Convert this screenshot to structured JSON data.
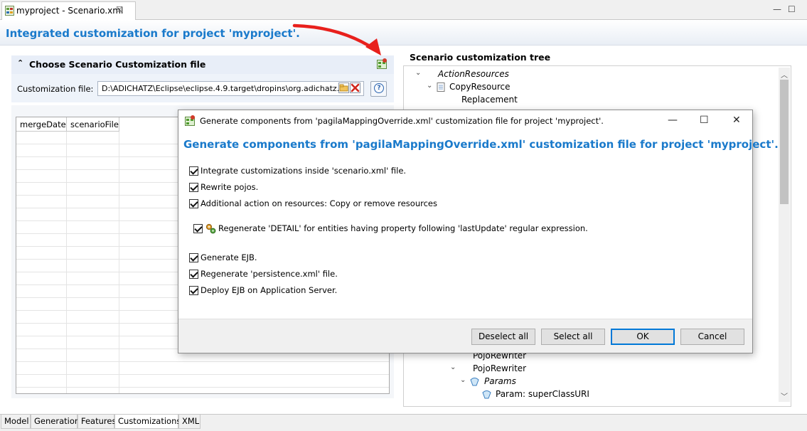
{
  "editor": {
    "tab_label": "myproject - Scenario.xml",
    "tab_close": "☒",
    "minimize": "—",
    "maximize": "☐",
    "title": "Integrated customization for project 'myproject'."
  },
  "section": {
    "title": "Choose Scenario Customization file",
    "twisty": "⌃",
    "field_label": "Customization file:",
    "field_value": "D:\\ADICHATZ\\Eclipse\\eclipse.4.9.target\\dropins\\org.adichatz.",
    "help_glyph": "?"
  },
  "table": {
    "columns": [
      "mergeDate",
      "scenarioFile"
    ]
  },
  "tree": {
    "title": "Scenario customization tree",
    "nodes": [
      {
        "label": "ActionResources",
        "expanded": "⌄"
      },
      {
        "label": "CopyResource",
        "expanded": "⌄"
      },
      {
        "label": "Replacement"
      },
      {
        "label": "PojoRewriter"
      },
      {
        "label": "PojoRewriter",
        "expanded": "⌄"
      },
      {
        "label": "Params",
        "expanded": "⌄"
      },
      {
        "label": "Param: superClassURI"
      }
    ]
  },
  "bottom_tabs": [
    "Model",
    "Generation",
    "Features",
    "Customizations",
    "XML"
  ],
  "active_bottom_tab": "Customizations",
  "dialog": {
    "title": "Generate components from 'pagilaMappingOverride.xml' customization file for project 'myproject'.",
    "heading": "Generate components from 'pagilaMappingOverride.xml' customization file for project 'myproject'.",
    "minimize": "—",
    "maximize": "☐",
    "close": "✕",
    "options": [
      {
        "label": "Integrate customizations inside 'scenario.xml' file.",
        "checked": true
      },
      {
        "label": "Rewrite pojos.",
        "checked": true
      },
      {
        "label": "Additional action on resources: Copy or remove resources",
        "checked": true
      },
      {
        "label": "Regenerate 'DETAIL' for entities having property following 'lastUpdate' regular expression.",
        "checked": true
      },
      {
        "label": "Generate EJB.",
        "checked": true
      },
      {
        "label": "Regenerate 'persistence.xml' file.",
        "checked": true
      },
      {
        "label": "Deploy EJB on Application Server.",
        "checked": true
      }
    ],
    "buttons": {
      "deselect_all": "Deselect all",
      "select_all": "Select all",
      "ok": "OK",
      "cancel": "Cancel"
    }
  },
  "colors": {
    "title_blue": "#1a7acb",
    "annotation_arrow": "#e8201c",
    "primary_button_border": "#0078d7"
  }
}
